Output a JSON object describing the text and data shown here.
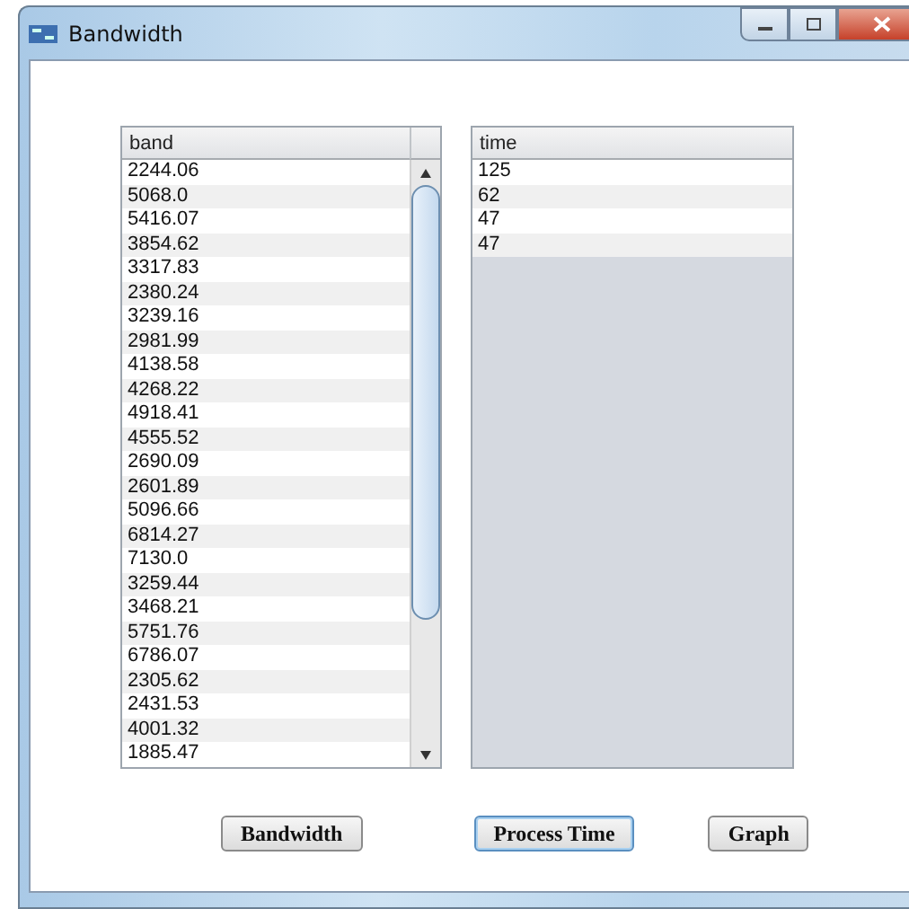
{
  "window": {
    "title": "Bandwidth"
  },
  "band_table": {
    "column": "band",
    "rows": [
      "2244.06",
      "5068.0",
      "5416.07",
      "3854.62",
      "3317.83",
      "2380.24",
      "3239.16",
      "2981.99",
      "4138.58",
      "4268.22",
      "4918.41",
      "4555.52",
      "2690.09",
      "2601.89",
      "5096.66",
      "6814.27",
      "7130.0",
      "3259.44",
      "3468.21",
      "5751.76",
      "6786.07",
      "2305.62",
      "2431.53",
      "4001.32",
      "1885.47"
    ]
  },
  "time_table": {
    "column": "time",
    "rows": [
      "125",
      "62",
      "47",
      "47"
    ]
  },
  "buttons": [
    {
      "label": "Bandwidth",
      "focused": false
    },
    {
      "label": "Process Time",
      "focused": true
    },
    {
      "label": "Graph",
      "focused": false
    }
  ]
}
